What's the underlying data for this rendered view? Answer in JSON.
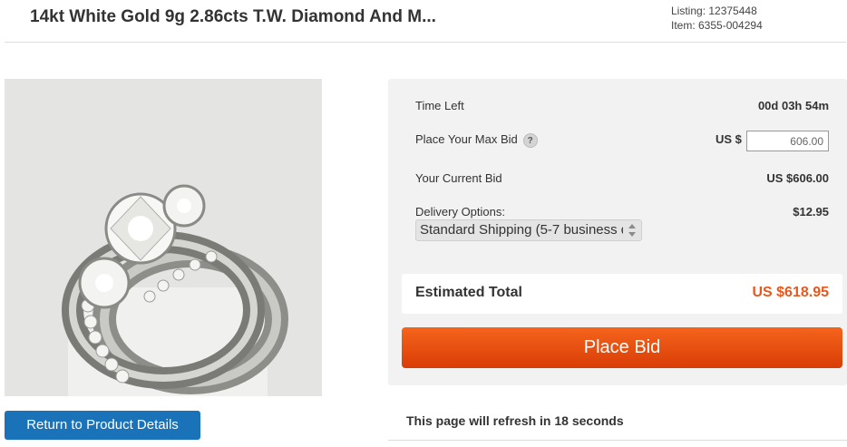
{
  "product": {
    "title": "14kt White Gold 9g 2.86cts T.W. Diamond And M...",
    "listing": "Listing: 12375448",
    "item": "Item: 6355-004294",
    "image_alt": "ring-photo"
  },
  "bid": {
    "time_left_label": "Time Left",
    "time_left_value": "00d 03h 54m",
    "max_bid_label": "Place Your Max Bid",
    "help_icon": "question-mark-icon",
    "help_glyph": "?",
    "currency": "US $",
    "max_bid_value": "606.00",
    "current_bid_label": "Your Current Bid",
    "current_bid_value": "US $606.00",
    "delivery_label": "Delivery Options:",
    "delivery_cost": "$12.95",
    "delivery_selected": "Standard Shipping (5-7 business d",
    "estimated_total_label": "Estimated Total",
    "estimated_total_value": "US $618.95",
    "place_bid_label": "Place Bid"
  },
  "footer": {
    "return_label": "Return to Product Details",
    "refresh_notice": "This page will refresh in 18 seconds"
  },
  "colors": {
    "accent_orange": "#e8581c",
    "button_blue": "#1a73b8",
    "panel_bg": "#f2f2f2"
  }
}
